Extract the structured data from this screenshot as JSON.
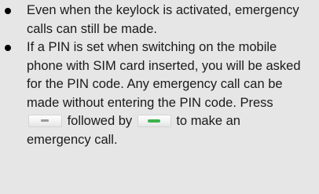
{
  "bullets": [
    {
      "text": "Even when the keylock is activated, emergency calls can still be made."
    },
    {
      "text_before_menu_key": "If a PIN is set when switching on the mobile phone with SIM card inserted, you will be asked for the PIN code. Any emergency call can be made without entering the PIN code. Press",
      "text_between_keys": "followed by",
      "text_after_call_key": "to make an emergency call."
    }
  ],
  "icons": {
    "menu_key": "menu-key-icon",
    "call_key": "call-key-icon",
    "call_key_color": "#3db24a"
  },
  "colors": {
    "background": "#e6e6e6",
    "text": "#1a1a1a"
  }
}
